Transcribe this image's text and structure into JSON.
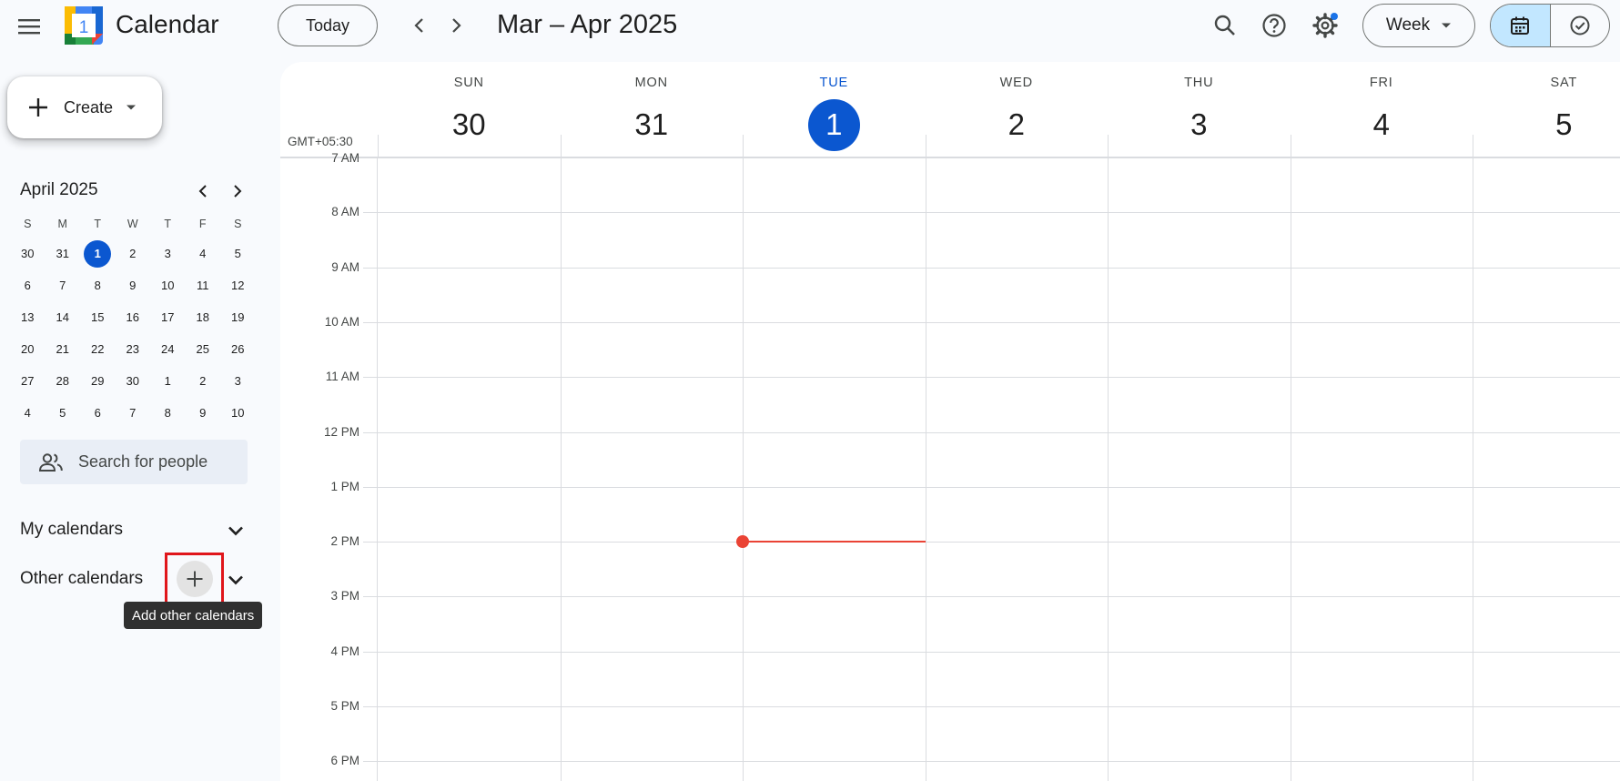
{
  "header": {
    "app_title": "Calendar",
    "logo_day": "1",
    "today_label": "Today",
    "range_title": "Mar – Apr 2025",
    "view_label": "Week",
    "colors": {
      "accent": "#0b57d0",
      "selected_segment": "#c2e7ff",
      "notification_dot": "#1a73e8"
    }
  },
  "sidebar": {
    "create_label": "Create",
    "mini_calendar": {
      "title": "April 2025",
      "weekday_headers": [
        "S",
        "M",
        "T",
        "W",
        "T",
        "F",
        "S"
      ],
      "weeks": [
        [
          "30",
          "31",
          "1",
          "2",
          "3",
          "4",
          "5"
        ],
        [
          "6",
          "7",
          "8",
          "9",
          "10",
          "11",
          "12"
        ],
        [
          "13",
          "14",
          "15",
          "16",
          "17",
          "18",
          "19"
        ],
        [
          "20",
          "21",
          "22",
          "23",
          "24",
          "25",
          "26"
        ],
        [
          "27",
          "28",
          "29",
          "30",
          "1",
          "2",
          "3"
        ],
        [
          "4",
          "5",
          "6",
          "7",
          "8",
          "9",
          "10"
        ]
      ],
      "today": "1"
    },
    "search_people_placeholder": "Search for people",
    "my_calendars_label": "My calendars",
    "other_calendars_label": "Other calendars",
    "add_other_calendars_tooltip": "Add other calendars"
  },
  "main": {
    "timezone": "GMT+05:30",
    "days": [
      {
        "name": "SUN",
        "num": "30",
        "today": false
      },
      {
        "name": "MON",
        "num": "31",
        "today": false
      },
      {
        "name": "TUE",
        "num": "1",
        "today": true
      },
      {
        "name": "WED",
        "num": "2",
        "today": false
      },
      {
        "name": "THU",
        "num": "3",
        "today": false
      },
      {
        "name": "FRI",
        "num": "4",
        "today": false
      },
      {
        "name": "SAT",
        "num": "5",
        "today": false
      }
    ],
    "time_labels": [
      "7 AM",
      "8 AM",
      "9 AM",
      "10 AM",
      "11 AM",
      "12 PM",
      "1 PM",
      "2 PM",
      "3 PM",
      "4 PM",
      "5 PM",
      "6 PM"
    ],
    "current_time_color": "#ea4335"
  }
}
